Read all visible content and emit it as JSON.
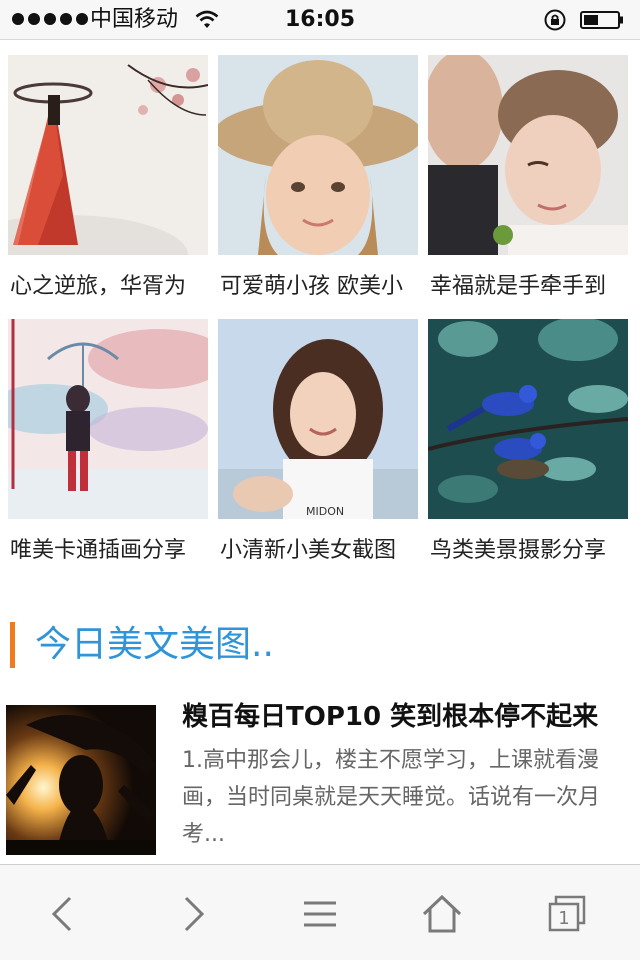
{
  "status_bar": {
    "carrier": "中国移动",
    "time": "16:05",
    "signal_icon": "signal-dots-icon",
    "wifi_icon": "wifi-icon",
    "lock_icon": "rotation-lock-icon",
    "battery_icon": "battery-icon"
  },
  "gallery": {
    "items": [
      {
        "caption": "心之逆旅，华胥为",
        "image": "ink-painting-woman-red-robe"
      },
      {
        "caption": "可爱萌小孩 欧美小",
        "image": "girl-straw-hat"
      },
      {
        "caption": "幸福就是手牵手到",
        "image": "couple-embrace"
      },
      {
        "caption": "唯美卡通插画分享",
        "image": "anime-girl-umbrella"
      },
      {
        "caption": "小清新小美女截图",
        "image": "smiling-young-woman"
      },
      {
        "caption": "鸟类美景摄影分享",
        "image": "blue-birds-on-branch"
      }
    ]
  },
  "section": {
    "title": "今日美文美图.."
  },
  "article": {
    "title": "糗百每日TOP10 笑到根本停不起来",
    "excerpt": "1.高中那会儿，楼主不愿学习，上课就看漫画，当时同桌就是天天睡觉。话说有一次月考...",
    "image": "silhouette-girl-sunset"
  },
  "toolbar": {
    "back_icon": "back-arrow-icon",
    "forward_icon": "forward-arrow-icon",
    "menu_icon": "menu-icon",
    "home_icon": "home-icon",
    "tabs_icon": "tabs-icon",
    "tabs_count": "1"
  },
  "colors": {
    "accent_bar": "#f07a1e",
    "section_title": "#2f95d8",
    "toolbar_icon": "#7a7a7a"
  }
}
